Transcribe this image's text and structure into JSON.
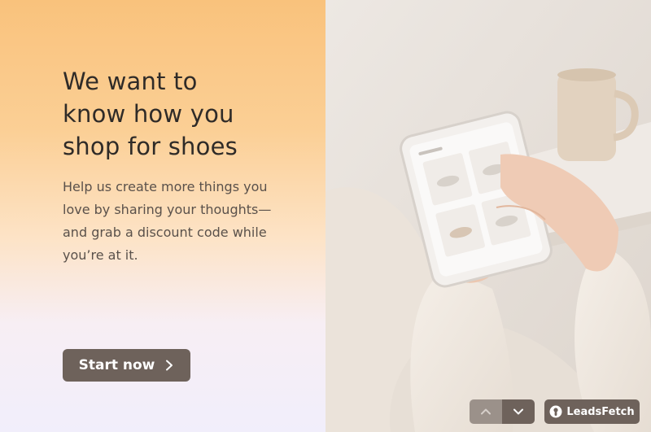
{
  "panel": {
    "headline": "We want to\nknow how you\nshop for shoes",
    "subtext": "Help us create more things you love by sharing your thoughts—and grab a discount code while you’re at it.",
    "start_button_label": "Start now"
  },
  "controls": {
    "prev_icon": "chevron-up-icon",
    "next_icon": "chevron-down-icon"
  },
  "branding": {
    "name": "LeadsFetch",
    "icon": "leadsfetch-logo-icon"
  },
  "colors": {
    "button": "#6e625b",
    "headline": "#2f2b28",
    "gradient_top": "#f9c27c",
    "gradient_bottom": "#f1eefb"
  }
}
